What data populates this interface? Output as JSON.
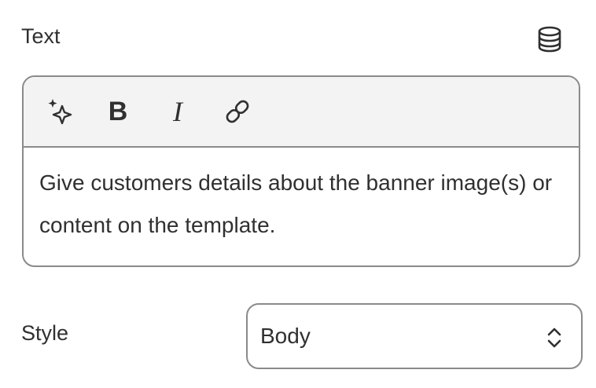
{
  "text_field": {
    "label": "Text",
    "icons": {
      "dynamic_source": "database-icon"
    },
    "toolbar": {
      "magic": "sparkle-icon",
      "bold": "B",
      "italic": "I",
      "link": "link-icon"
    },
    "value": "Give customers details about the banner image(s) or content on the template."
  },
  "style_field": {
    "label": "Style",
    "selected": "Body",
    "icon": "select-chevrons-icon"
  },
  "colors": {
    "text": "#303030",
    "border": "#8a8a8a",
    "toolbar_bg": "#f3f3f3"
  }
}
